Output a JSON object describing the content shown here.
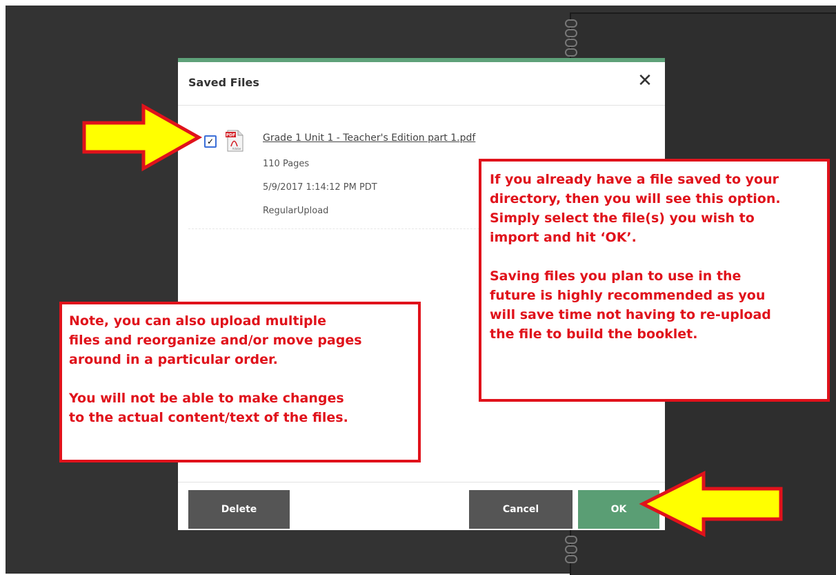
{
  "dialog": {
    "title": "Saved Files",
    "close_icon": "close-icon",
    "accent_color": "#5ea179"
  },
  "file": {
    "checked": true,
    "icon": "pdf-file-icon",
    "icon_label": "PDF",
    "icon_sublabel": "Adobe",
    "name": "Grade 1 Unit 1 - Teacher's Edition part 1.pdf",
    "pages": "110 Pages",
    "date": "5/9/2017 1:14:12 PM PDT",
    "upload_type": "RegularUpload"
  },
  "buttons": {
    "delete": "Delete",
    "cancel": "Cancel",
    "ok": "OK"
  },
  "annotations": {
    "right_lines_1": [
      "If you already have a file saved to your",
      "directory, then you will see this option.",
      "Simply select the file(s) you wish to",
      "import and hit ‘OK’."
    ],
    "right_lines_2": [
      "Saving files you plan to use in the",
      "future is highly recommended as you",
      "will save time not having to re-upload",
      "the file to build the booklet."
    ],
    "left_lines_1": [
      "Note, you can also upload multiple",
      "files and reorganize and/or move pages",
      "around in a particular order."
    ],
    "left_lines_2": [
      "You will not be able to make changes",
      "to the actual content/text of the files."
    ],
    "arrow_color": "#ffff00",
    "outline_color": "#e0121b"
  }
}
